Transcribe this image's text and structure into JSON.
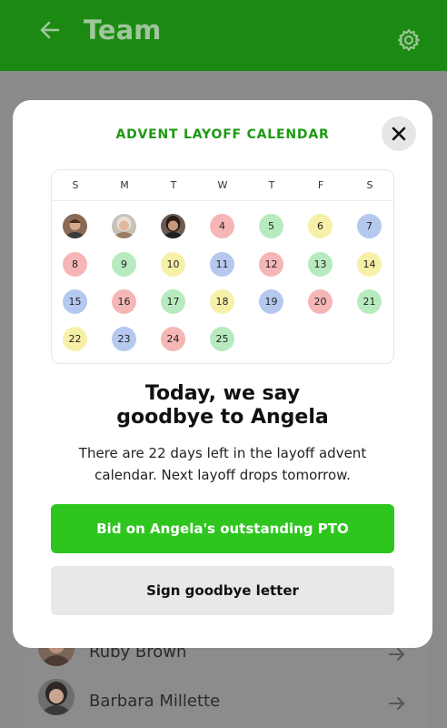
{
  "app": {
    "title": "Team",
    "back_icon": "arrow-left-icon",
    "settings_icon": "gear-icon",
    "bar_color": "#1c8a12"
  },
  "background_list": {
    "items": [
      {
        "name": "Ruby Brown"
      },
      {
        "name": "Barbara Millette"
      }
    ]
  },
  "modal": {
    "heading": "ADVENT LAYOFF CALENDAR",
    "close_icon": "close-icon",
    "calendar": {
      "weekdays": [
        "S",
        "M",
        "T",
        "W",
        "T",
        "F",
        "S"
      ],
      "photo_days": [
        "avatar-1",
        "avatar-2",
        "avatar-3"
      ],
      "days": [
        "4",
        "5",
        "6",
        "7",
        "8",
        "9",
        "10",
        "11",
        "12",
        "13",
        "14",
        "15",
        "16",
        "17",
        "18",
        "19",
        "20",
        "21",
        "22",
        "23",
        "24",
        "25"
      ],
      "day_colors": {
        "red": "#f6b6b6",
        "green": "#b8eabf",
        "yellow": "#f7f0a8",
        "blue": "#b5c9ef"
      }
    },
    "headline_line1": "Today, we say",
    "headline_line2": "goodbye to Angela",
    "body_line1": "There are 22 days left in the layoff advent",
    "body_line2": "calendar. Next layoff drops tomorrow.",
    "primary_button": "Bid on Angela's outstanding PTO",
    "secondary_button": "Sign goodbye letter",
    "accent_color": "#2ec51f"
  }
}
